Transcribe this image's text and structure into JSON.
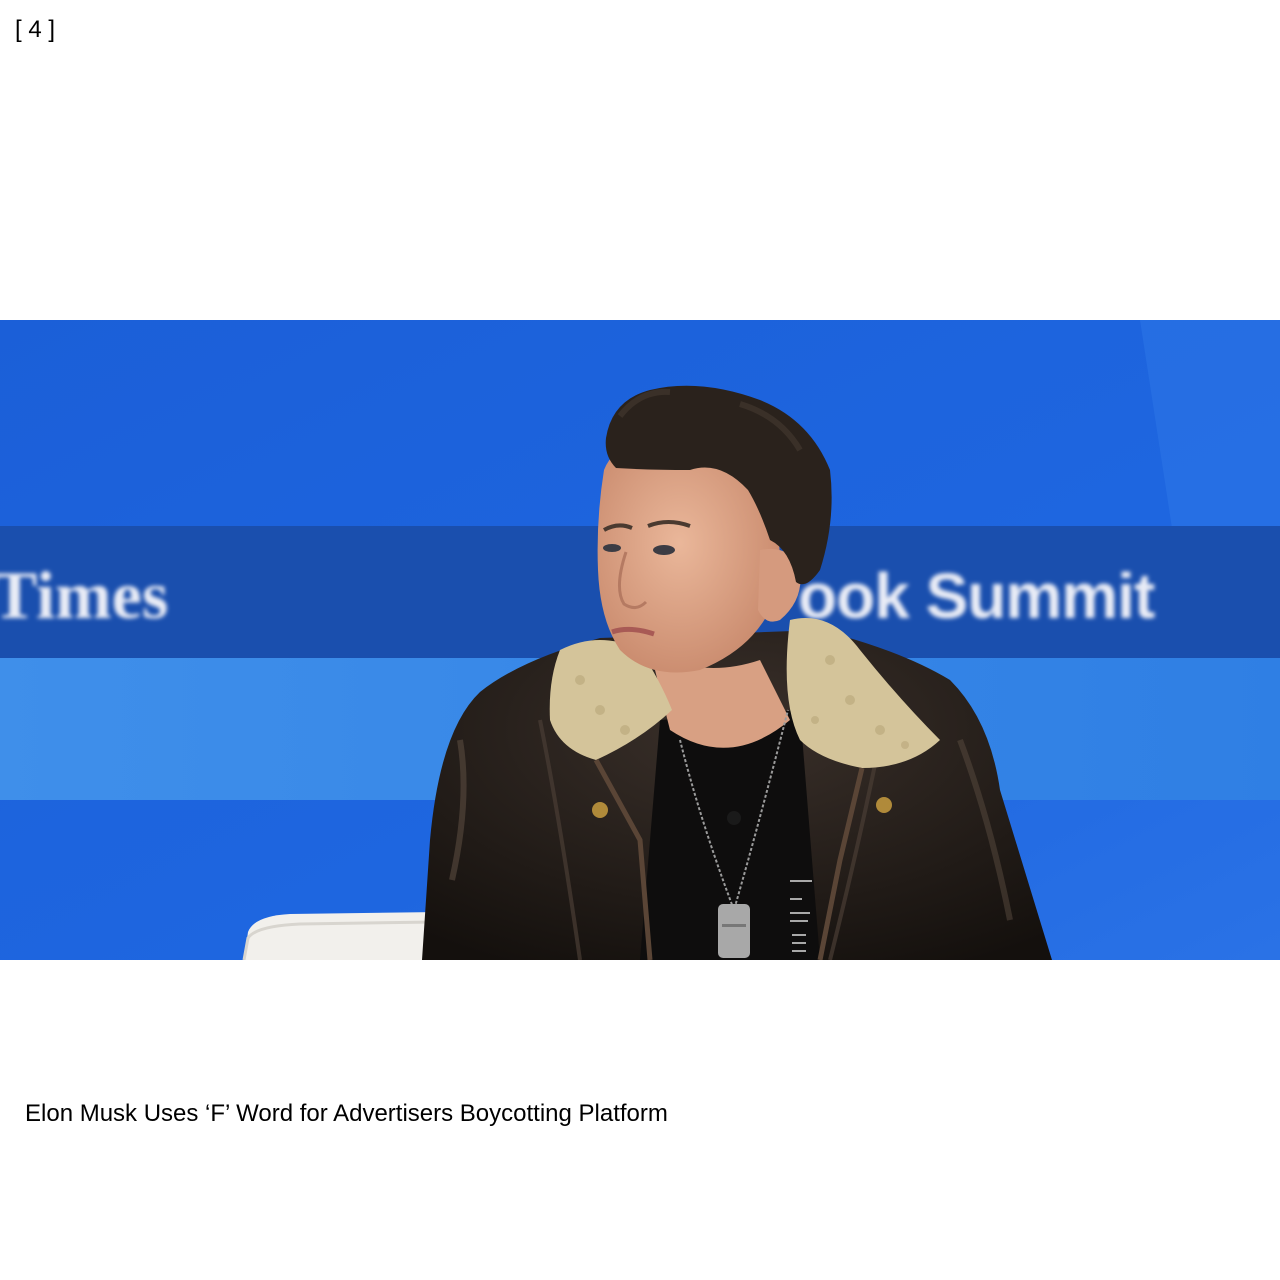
{
  "index_label": "[ 4 ]",
  "photo": {
    "backdrop_text_left": "Times",
    "backdrop_text_right": "ook Summit",
    "colors": {
      "backdrop_blue": "#1e64dc",
      "band_dark_blue": "#1a4fae",
      "band_light_blue": "#3d8ee8",
      "jacket": "#231c17",
      "collar": "#d4c49a",
      "skin": "#e0a888",
      "hair": "#2a221c",
      "chair": "#f2f0ec"
    }
  },
  "caption": "Elon Musk Uses ‘F’ Word for Advertisers Boycotting Platform"
}
